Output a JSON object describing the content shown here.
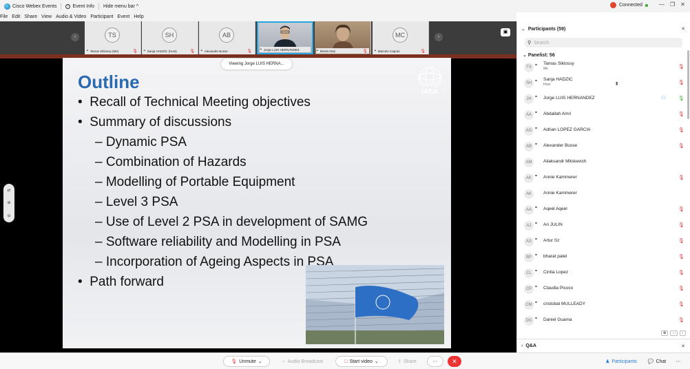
{
  "titlebar": {
    "app_name": "Cisco Webex Events",
    "event_info": "Event Info",
    "hide_menu": "Hide menu bar ^",
    "connection": "Connected"
  },
  "menu": [
    "File",
    "Edit",
    "Share",
    "View",
    "Audio & Video",
    "Participant",
    "Event",
    "Help"
  ],
  "filmstrip": {
    "tiles": [
      {
        "initials": "TS",
        "name": "Tamas Siklossy (Me)"
      },
      {
        "initials": "SH",
        "name": "Sanja HADZIC (Host)"
      },
      {
        "initials": "AB",
        "name": "Alexander Busse"
      },
      {
        "initials": "",
        "name": "Jorge LUIS HERNANDEZ"
      },
      {
        "initials": "",
        "name": "Mirela Nitoi"
      },
      {
        "initials": "MC",
        "name": "Marcelo Caputo"
      }
    ]
  },
  "share": {
    "viewing_label": "Viewing Jorge LUIS HERNA...",
    "slide": {
      "title": "Outline",
      "logo_text": "IAEA",
      "bullets": [
        "Recall of Technical Meeting objectives",
        "Summary of discussions",
        "– Dynamic PSA",
        "– Combination of Hazards",
        "– Modelling of Portable Equipment",
        "– Level 3 PSA",
        "– Use of Level 2 PSA in development of SAMG",
        "– Software reliability and Modelling in PSA",
        "– Incorporation of Ageing Aspects in PSA",
        "Path forward"
      ]
    }
  },
  "toolbar": {
    "unmute": "Unmute",
    "audio_broadcast": "Audio Broadcast",
    "start_video": "Start video",
    "share": "Share",
    "participants": "Participants",
    "chat": "Chat"
  },
  "panel": {
    "title": "Participants (59)",
    "search_placeholder": "Search",
    "panelist_header": "Panelist: 56",
    "participants": [
      {
        "initials": "TS",
        "name": "Tamas Siklossy",
        "sub": "Me"
      },
      {
        "initials": "SH",
        "name": "Sanja HADZIC",
        "sub": "Host"
      },
      {
        "initials": "JH",
        "name": "Jorge LUIS HERNANDEZ",
        "sub": ""
      },
      {
        "initials": "AA",
        "name": "Abdallah Amri",
        "sub": ""
      },
      {
        "initials": "AG",
        "name": "Adrian LOPEZ GARCIA",
        "sub": ""
      },
      {
        "initials": "AB",
        "name": "Alexander Busse",
        "sub": ""
      },
      {
        "initials": "AM",
        "name": "Aliaksandr Mitskevich",
        "sub": ""
      },
      {
        "initials": "AK",
        "name": "Annie Kammerer",
        "sub": ""
      },
      {
        "initials": "AK",
        "name": "Annie Kammerer",
        "sub": ""
      },
      {
        "initials": "AA",
        "name": "Aqeel Aqeel",
        "sub": ""
      },
      {
        "initials": "AJ",
        "name": "Ari JULIN",
        "sub": ""
      },
      {
        "initials": "AS",
        "name": "Artur Sz",
        "sub": ""
      },
      {
        "initials": "BP",
        "name": "bharat patel",
        "sub": ""
      },
      {
        "initials": "CL",
        "name": "Cintia Lopez",
        "sub": ""
      },
      {
        "initials": "CP",
        "name": "Claudia Picoco",
        "sub": ""
      },
      {
        "initials": "CM",
        "name": "cristobal MULLEADY",
        "sub": ""
      },
      {
        "initials": "DG",
        "name": "Daniel Guama",
        "sub": ""
      }
    ],
    "qa_title": "Q&A"
  },
  "colors": {
    "accent": "#2a6ab1",
    "active_tile": "#27a7e0",
    "end": "#ee3333",
    "muted": "#dd3333"
  }
}
